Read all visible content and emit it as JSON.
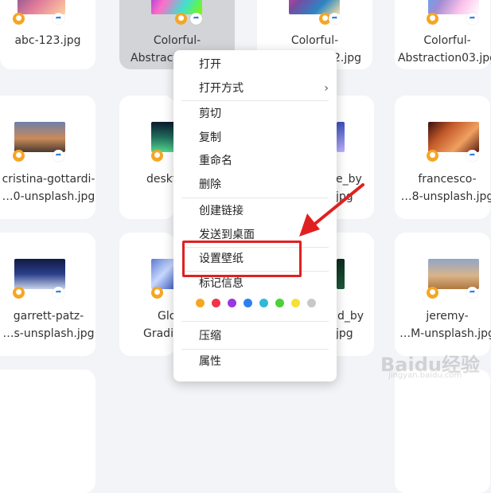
{
  "files": [
    {
      "name_line1": "abc-123.jpg",
      "name_line2": "",
      "selected": false
    },
    {
      "name_line1": "Colorful-",
      "name_line2": "Abstract",
      "selected": true
    },
    {
      "name_line1": "Colorful-",
      "name_line2": "…2.jpg",
      "selected": false
    },
    {
      "name_line1": "Colorful-",
      "name_line2": "Abstraction03.jpg",
      "selected": false
    },
    {
      "name_line1": "cristina-gottardi-",
      "name_line2": "…0-unsplash.jpg",
      "selected": false
    },
    {
      "name_line1": "deskt",
      "name_line2": "",
      "selected": false
    },
    {
      "name_line1": "e_by",
      "name_line2": "jpg",
      "selected": false
    },
    {
      "name_line1": "francesco-",
      "name_line2": "…8-unsplash.jpg",
      "selected": false
    },
    {
      "name_line1": "garrett-patz-",
      "name_line2": "…s-unsplash.jpg",
      "selected": false
    },
    {
      "name_line1": "Glo",
      "name_line2": "Gradi",
      "selected": false
    },
    {
      "name_line1": "d_by",
      "name_line2": "jpg",
      "selected": false
    },
    {
      "name_line1": "jeremy-",
      "name_line2": "…M-unsplash.jpg",
      "selected": false
    }
  ],
  "context_menu": {
    "open": "打开",
    "open_with": "打开方式",
    "open_with_arrow": "›",
    "cut": "剪切",
    "copy": "复制",
    "rename": "重命名",
    "delete": "删除",
    "create_link": "创建链接",
    "send_to_desktop": "发送到桌面",
    "set_wallpaper": "设置壁纸",
    "tag_info": "标记信息",
    "compress": "压缩",
    "properties": "属性",
    "tag_colors": [
      "#f5a623",
      "#f0344b",
      "#9b36e0",
      "#2f7ef0",
      "#2fb8d8",
      "#4cd137",
      "#f7e035",
      "#c8c8c8"
    ]
  },
  "annotation": {
    "highlight_color": "#e02020"
  },
  "watermark": {
    "text": "Baidu经验",
    "sub": "jingyan.baidu.com"
  }
}
